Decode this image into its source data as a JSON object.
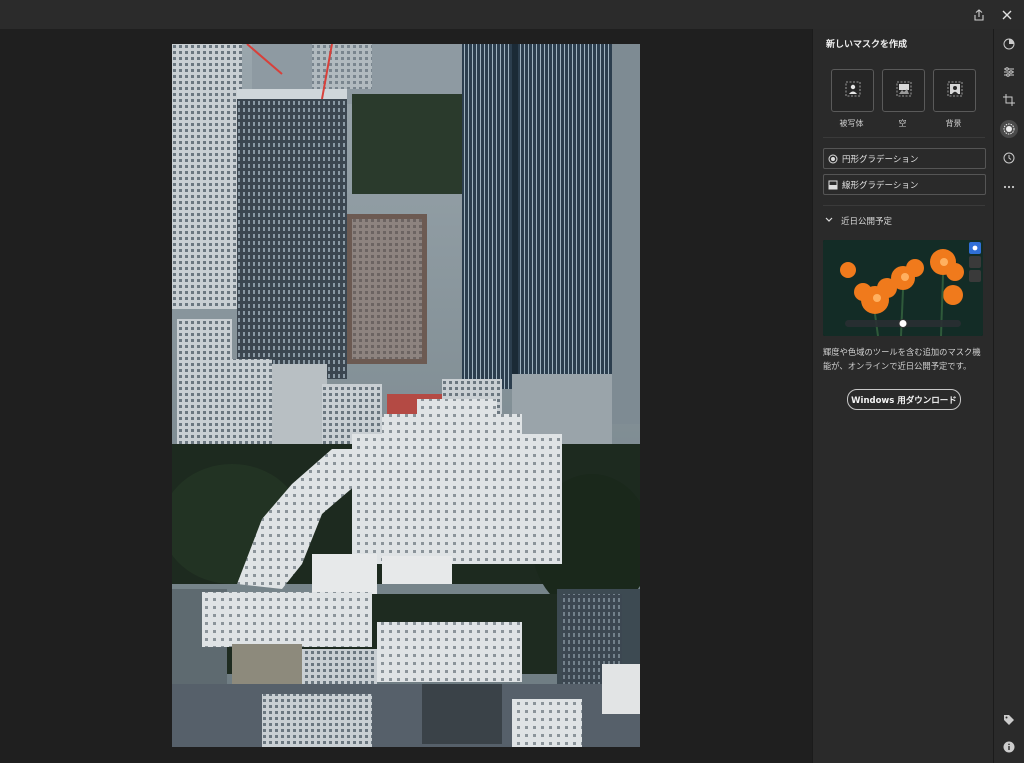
{
  "header": {
    "share_icon": "share-icon",
    "close_icon": "close-icon"
  },
  "photo": {
    "description_icon": "photo-image",
    "sky_color": "#5c6a74",
    "foliage_color": "#1c2a1f"
  },
  "mask_panel": {
    "title": "新しいマスクを作成",
    "auto_masks": [
      {
        "label": "被写体",
        "icon": "person-icon"
      },
      {
        "label": "空",
        "icon": "sky-icon"
      },
      {
        "label": "背景",
        "icon": "background-icon"
      }
    ],
    "gradients": [
      {
        "label": "円形グラデーション",
        "icon": "radial-gradient-icon"
      },
      {
        "label": "線形グラデーション",
        "icon": "linear-gradient-icon"
      }
    ],
    "coming_soon": {
      "heading": "近日公開予定",
      "description": "輝度や色域のツールを含む追加のマスク機能が、オンラインで近日公開予定です。",
      "download_label": "Windows 用ダウンロード"
    }
  },
  "toolbar": {
    "tools": [
      {
        "name": "edit-icon",
        "active": false
      },
      {
        "name": "sliders-icon",
        "active": false
      },
      {
        "name": "crop-icon",
        "active": false
      },
      {
        "name": "mask-icon",
        "active": true
      },
      {
        "name": "history-icon",
        "active": false
      },
      {
        "name": "more-icon",
        "active": false
      }
    ],
    "bottom_tools": [
      "tag-icon",
      "info-icon"
    ]
  }
}
